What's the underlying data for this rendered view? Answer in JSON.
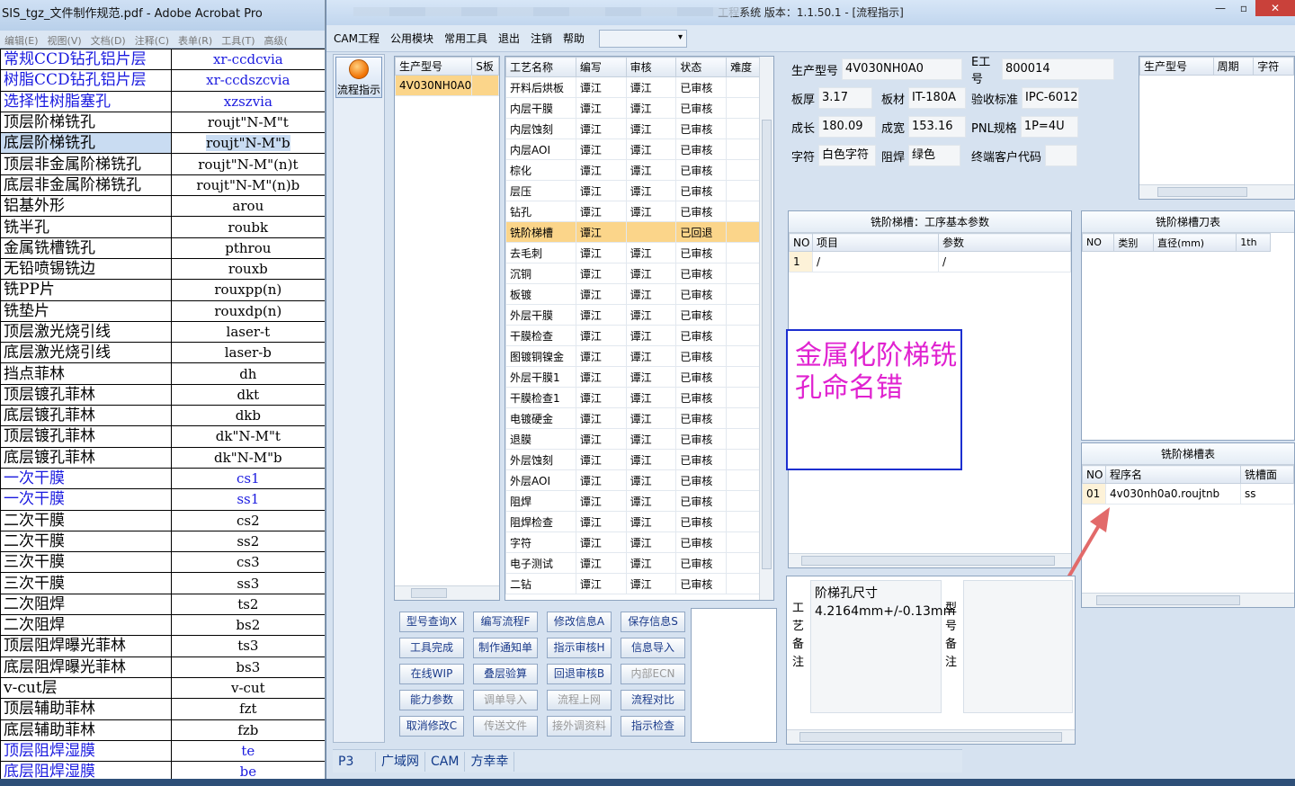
{
  "acrobat": {
    "title": "SIS_tgz_文件制作规范.pdf - Adobe Acrobat Pro",
    "menu": [
      "编辑(E)",
      "视图(V)",
      "文档(D)",
      "注释(C)",
      "表单(R)",
      "工具(T)",
      "高级("
    ],
    "rows": [
      {
        "name": "常规CCD钻孔铝片层",
        "code": "xr-ccdcvia",
        "blue": true
      },
      {
        "name": "树脂CCD钻孔铝片层",
        "code": "xr-ccdszcvia",
        "blue": true
      },
      {
        "name": "选择性树脂塞孔",
        "code": "xzszvia",
        "blue": true
      },
      {
        "name": "顶层阶梯铣孔",
        "code": "roujt\"N-M\"t",
        "blue": false
      },
      {
        "name": "底层阶梯铣孔",
        "code": "roujt\"N-M\"b",
        "blue": false,
        "selected": true
      },
      {
        "name": "顶层非金属阶梯铣孔",
        "code": "roujt\"N-M\"(n)t",
        "blue": false
      },
      {
        "name": "底层非金属阶梯铣孔",
        "code": "roujt\"N-M\"(n)b",
        "blue": false
      },
      {
        "name": "铝基外形",
        "code": "arou",
        "blue": false
      },
      {
        "name": "铣半孔",
        "code": "roubk",
        "blue": false
      },
      {
        "name": "金属铣槽铣孔",
        "code": "pthrou",
        "blue": false
      },
      {
        "name": "无铅喷锡铣边",
        "code": "rouxb",
        "blue": false
      },
      {
        "name": "铣PP片",
        "code": "rouxpp(n)",
        "blue": false
      },
      {
        "name": "铣垫片",
        "code": "rouxdp(n)",
        "blue": false
      },
      {
        "name": "顶层激光烧引线",
        "code": "laser-t",
        "blue": false
      },
      {
        "name": "底层激光烧引线",
        "code": "laser-b",
        "blue": false
      },
      {
        "name": "挡点菲林",
        "code": "dh",
        "blue": false
      },
      {
        "name": "顶层镀孔菲林",
        "code": "dkt",
        "blue": false
      },
      {
        "name": "底层镀孔菲林",
        "code": "dkb",
        "blue": false
      },
      {
        "name": "顶层镀孔菲林",
        "code": "dk\"N-M\"t",
        "blue": false
      },
      {
        "name": "底层镀孔菲林",
        "code": "dk\"N-M\"b",
        "blue": false
      },
      {
        "name": "一次干膜",
        "code": "cs1",
        "blue": true
      },
      {
        "name": "一次干膜",
        "code": "ss1",
        "blue": true
      },
      {
        "name": "二次干膜",
        "code": "cs2",
        "blue": false
      },
      {
        "name": "二次干膜",
        "code": "ss2",
        "blue": false
      },
      {
        "name": "三次干膜",
        "code": "cs3",
        "blue": false
      },
      {
        "name": "三次干膜",
        "code": "ss3",
        "blue": false
      },
      {
        "name": "二次阻焊",
        "code": "ts2",
        "blue": false
      },
      {
        "name": "二次阻焊",
        "code": "bs2",
        "blue": false
      },
      {
        "name": "顶层阻焊曝光菲林",
        "code": "ts3",
        "blue": false
      },
      {
        "name": "底层阻焊曝光菲林",
        "code": "bs3",
        "blue": false
      },
      {
        "name": "v-cut层",
        "code": "v-cut",
        "blue": false
      },
      {
        "name": "顶层辅助菲林",
        "code": "fzt",
        "blue": false
      },
      {
        "name": "底层辅助菲林",
        "code": "fzb",
        "blue": false
      },
      {
        "name": "顶层阻焊湿膜",
        "code": "te",
        "blue": true
      },
      {
        "name": "底层阻焊湿膜",
        "code": "be",
        "blue": true
      }
    ]
  },
  "erp": {
    "title": "工程系统   版本：1.1.50.1 - [流程指示]",
    "menu": [
      "CAM工程",
      "公用模块",
      "常用工具",
      "退出",
      "注销",
      "帮助"
    ],
    "sidebar_button": "流程指示",
    "model_table": {
      "headers": [
        "生产型号",
        "S板"
      ],
      "rows": [
        [
          "4V030NH0A0",
          ""
        ]
      ]
    },
    "process_table": {
      "headers": [
        "工艺名称",
        "编写",
        "审核",
        "状态",
        "难度"
      ],
      "rows": [
        [
          "开料后烘板",
          "谭江",
          "谭江",
          "已审核",
          ""
        ],
        [
          "内层干膜",
          "谭江",
          "谭江",
          "已审核",
          ""
        ],
        [
          "内层蚀刻",
          "谭江",
          "谭江",
          "已审核",
          ""
        ],
        [
          "内层AOI",
          "谭江",
          "谭江",
          "已审核",
          ""
        ],
        [
          "棕化",
          "谭江",
          "谭江",
          "已审核",
          ""
        ],
        [
          "层压",
          "谭江",
          "谭江",
          "已审核",
          ""
        ],
        [
          "钻孔",
          "谭江",
          "谭江",
          "已审核",
          ""
        ],
        [
          "铣阶梯槽",
          "谭江",
          "",
          "已回退",
          ""
        ],
        [
          "去毛刺",
          "谭江",
          "谭江",
          "已审核",
          ""
        ],
        [
          "沉铜",
          "谭江",
          "谭江",
          "已审核",
          ""
        ],
        [
          "板镀",
          "谭江",
          "谭江",
          "已审核",
          ""
        ],
        [
          "外层干膜",
          "谭江",
          "谭江",
          "已审核",
          ""
        ],
        [
          "干膜检查",
          "谭江",
          "谭江",
          "已审核",
          ""
        ],
        [
          "图镀铜镍金",
          "谭江",
          "谭江",
          "已审核",
          ""
        ],
        [
          "外层干膜1",
          "谭江",
          "谭江",
          "已审核",
          ""
        ],
        [
          "干膜检查1",
          "谭江",
          "谭江",
          "已审核",
          ""
        ],
        [
          "电镀硬金",
          "谭江",
          "谭江",
          "已审核",
          ""
        ],
        [
          "退膜",
          "谭江",
          "谭江",
          "已审核",
          ""
        ],
        [
          "外层蚀刻",
          "谭江",
          "谭江",
          "已审核",
          ""
        ],
        [
          "外层AOI",
          "谭江",
          "谭江",
          "已审核",
          ""
        ],
        [
          "阻焊",
          "谭江",
          "谭江",
          "已审核",
          ""
        ],
        [
          "阻焊检查",
          "谭江",
          "谭江",
          "已审核",
          ""
        ],
        [
          "字符",
          "谭江",
          "谭江",
          "已审核",
          ""
        ],
        [
          "电子测试",
          "谭江",
          "谭江",
          "已审核",
          ""
        ],
        [
          "二钻",
          "谭江",
          "谭江",
          "已审核",
          ""
        ]
      ]
    },
    "buttons": [
      {
        "label": "型号查询X",
        "enabled": true
      },
      {
        "label": "编写流程F",
        "enabled": true
      },
      {
        "label": "修改信息A",
        "enabled": true
      },
      {
        "label": "保存信息S",
        "enabled": true
      },
      {
        "label": "工具完成",
        "enabled": true
      },
      {
        "label": "制作通知单",
        "enabled": true
      },
      {
        "label": "指示审核H",
        "enabled": true
      },
      {
        "label": "信息导入",
        "enabled": true
      },
      {
        "label": "在线WIP",
        "enabled": true
      },
      {
        "label": "叠层验算",
        "enabled": true
      },
      {
        "label": "回退审核B",
        "enabled": true
      },
      {
        "label": "内部ECN",
        "enabled": false
      },
      {
        "label": "能力参数",
        "enabled": true
      },
      {
        "label": "调单导入",
        "enabled": false
      },
      {
        "label": "流程上网",
        "enabled": false
      },
      {
        "label": "流程对比",
        "enabled": true
      },
      {
        "label": "取消修改C",
        "enabled": true
      },
      {
        "label": "传送文件",
        "enabled": false
      },
      {
        "label": "接外调资料",
        "enabled": false
      },
      {
        "label": "指示检查",
        "enabled": true
      }
    ],
    "info": {
      "prod_model_label": "生产型号",
      "prod_model": "4V030NH0A0",
      "e_no_label": "E工号",
      "e_no": "800014",
      "thick_label": "板厚",
      "thick": "3.17",
      "material_label": "板材",
      "material": "IT-180A",
      "standard_label": "验收标准",
      "standard": "IPC-6012",
      "len_label": "成长",
      "len": "180.09",
      "wid_label": "成宽",
      "wid": "153.16",
      "pnl_label": "PNL规格",
      "pnl": "1P=4U",
      "char_label": "字符",
      "char": "白色字符",
      "mask_label": "阻焊",
      "mask": "绿色",
      "cust_label": "终端客户代码",
      "cust": ""
    },
    "rtop_headers": [
      "生产型号",
      "周期",
      "字符"
    ],
    "param_panel": {
      "title": "铣阶梯槽：工序基本参数",
      "headers": [
        "NO",
        "项目",
        "参数"
      ],
      "rows": [
        [
          "1",
          "/",
          "/"
        ]
      ]
    },
    "tool_panel": {
      "title": "铣阶梯槽刀表",
      "headers": [
        "NO",
        "类别",
        "直径(mm)",
        "1th"
      ]
    },
    "slot_panel": {
      "title": "铣阶梯槽表",
      "headers": [
        "NO",
        "程序名",
        "铣槽面"
      ],
      "rows": [
        [
          "01",
          "4v030nh0a0.roujtnb",
          "ss"
        ]
      ]
    },
    "annotation": "金属化阶梯铣孔命名错",
    "remark": {
      "craft_label": "工艺备注",
      "craft_text": "阶梯孔尺寸4.2164mm+/-0.13mm",
      "model_label": "型号备注"
    },
    "status": [
      "P3",
      "广域网",
      "CAM",
      "方幸幸"
    ]
  }
}
